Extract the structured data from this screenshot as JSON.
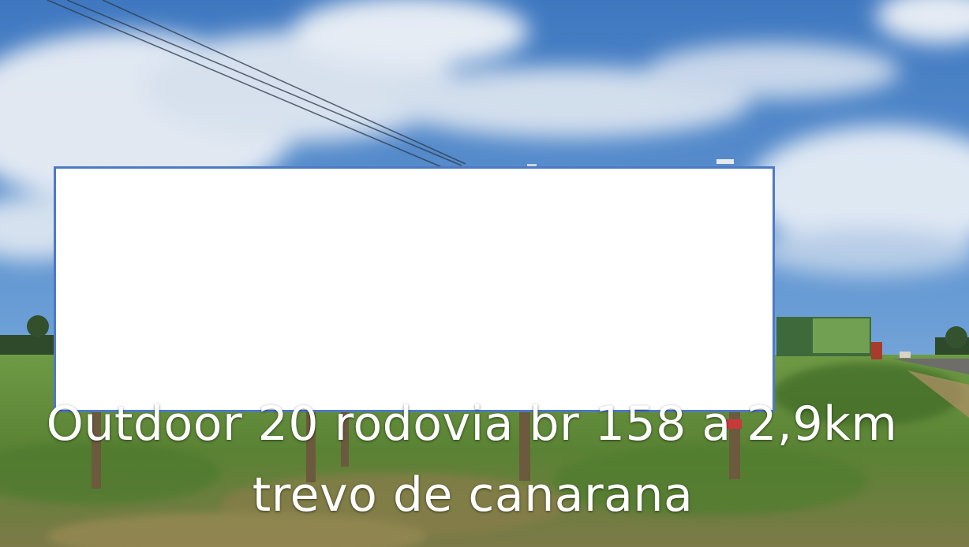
{
  "caption": {
    "line1": "Outdoor 20 rodovia br 158 a 2,9km",
    "line2": "trevo de canarana"
  },
  "colors": {
    "sky_top": "#3f78c0",
    "sky_bottom": "#8fb6e0",
    "grass": "#5f8a3a",
    "billboard_face": "#ffffff",
    "billboard_border": "#4e79c4"
  }
}
